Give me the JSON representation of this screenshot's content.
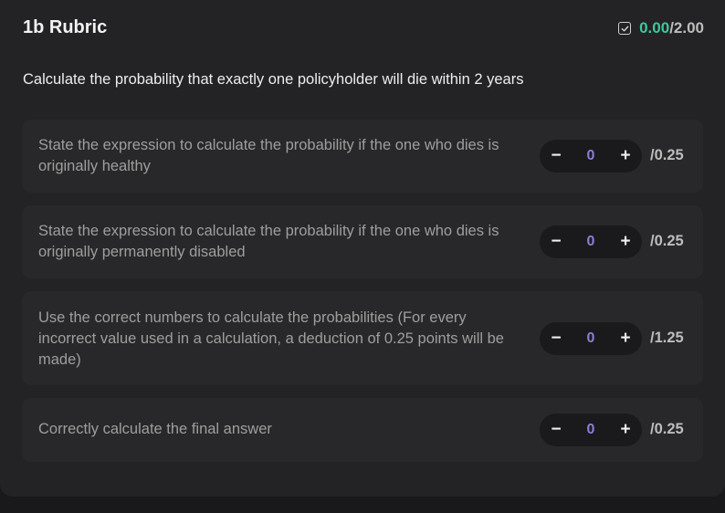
{
  "header": {
    "title": "1b Rubric",
    "score": "0.00",
    "score_total": "/2.00"
  },
  "question": "Calculate the probability that exactly one policyholder will die within 2 years",
  "criteria": [
    {
      "text": "State the expression to calculate the probability if the one who dies is originally healthy",
      "value": "0",
      "max": "/0.25",
      "minus": "−",
      "plus": "+"
    },
    {
      "text": "State the expression to calculate the probability if the one who dies is originally permanently disabled",
      "value": "0",
      "max": "/0.25",
      "minus": "−",
      "plus": "+"
    },
    {
      "text": "Use the correct numbers to calculate the probabilities (For every incorrect value used in a calculation, a deduction of 0.25 points will be made)",
      "value": "0",
      "max": "/1.25",
      "minus": "−",
      "plus": "+"
    },
    {
      "text": "Correctly calculate the final answer",
      "value": "0",
      "max": "/0.25",
      "minus": "−",
      "plus": "+"
    }
  ],
  "colors": {
    "score_accent": "#3ec89a",
    "stepper_value": "#8a7fd6"
  },
  "icons": {
    "score_icon": "checkbox-check-icon"
  }
}
